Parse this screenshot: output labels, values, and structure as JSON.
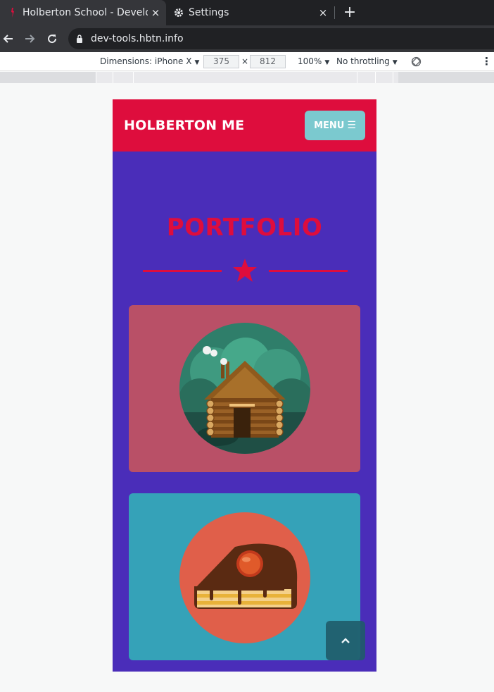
{
  "browser": {
    "tabs": [
      {
        "title": "Holberton School - Develo",
        "close_glyph": "×"
      },
      {
        "title": "Settings",
        "close_glyph": "×"
      }
    ],
    "new_tab_glyph": "+",
    "url": "dev-tools.hbtn.info"
  },
  "devtools": {
    "dimensions_label": "Dimensions: iPhone X",
    "width": "375",
    "times": "×",
    "height": "812",
    "zoom": "100%",
    "throttling": "No throttling",
    "more_glyph": "⋮"
  },
  "site": {
    "brand": "HOLBERTON ME",
    "menu_label": "MENU",
    "menu_icon": "bars-icon",
    "section_title": "PORTFOLIO",
    "colors": {
      "header": "#de0d3d",
      "body": "#4a2db9",
      "menu_button": "#7bc9cf",
      "card_1": "#b95067",
      "card_2": "#35a2b8"
    },
    "portfolio_items": [
      {
        "image": "cabin-illustration"
      },
      {
        "image": "cake-slice-illustration"
      }
    ],
    "scroll_top_icon": "chevron-up-icon"
  }
}
